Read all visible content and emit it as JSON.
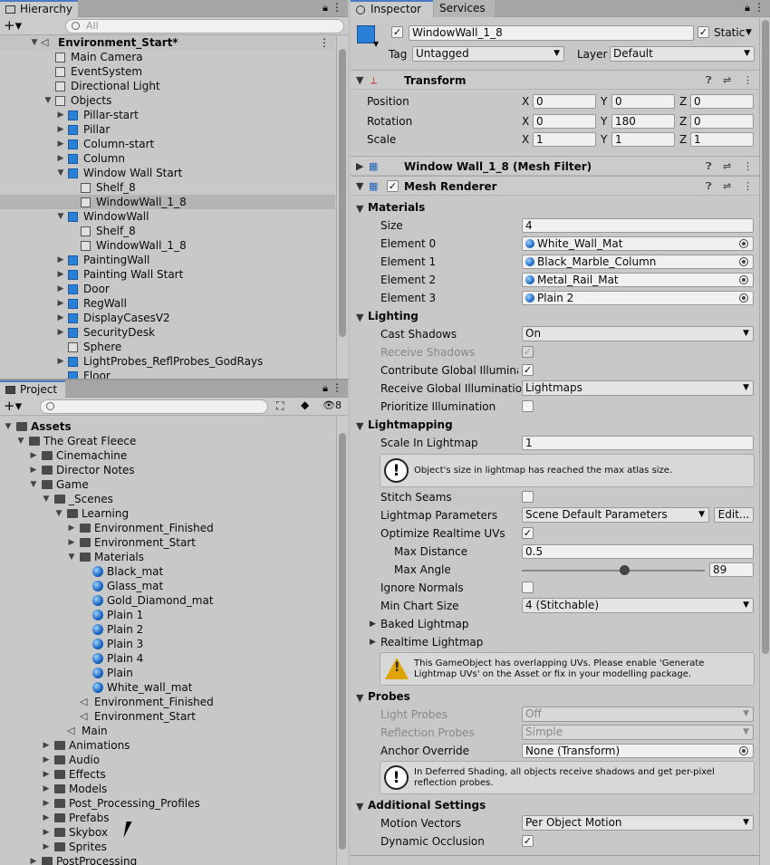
{
  "hierarchy": {
    "tab": "Hierarchy",
    "search_placeholder": "All",
    "scene": "Environment_Start*",
    "items": [
      {
        "label": "Main Camera"
      },
      {
        "label": "EventSystem"
      },
      {
        "label": "Directional Light"
      },
      {
        "label": "Objects"
      },
      {
        "label": "Pillar-start"
      },
      {
        "label": "Pillar"
      },
      {
        "label": "Column-start"
      },
      {
        "label": "Column"
      },
      {
        "label": "Window Wall Start"
      },
      {
        "label": "Shelf_8"
      },
      {
        "label": "WindowWall_1_8"
      },
      {
        "label": "WindowWall"
      },
      {
        "label": "Shelf_8"
      },
      {
        "label": "WindowWall_1_8"
      },
      {
        "label": "PaintingWall"
      },
      {
        "label": "Painting Wall Start"
      },
      {
        "label": "Door"
      },
      {
        "label": "RegWall"
      },
      {
        "label": "DisplayCasesV2"
      },
      {
        "label": "SecurityDesk"
      },
      {
        "label": "Sphere"
      },
      {
        "label": "LightProbes_ReflProbes_GodRays"
      },
      {
        "label": "Floor"
      }
    ]
  },
  "project": {
    "tab": "Project",
    "hidden_count": "8",
    "items": [
      {
        "label": "Assets"
      },
      {
        "label": "The Great Fleece"
      },
      {
        "label": "Cinemachine"
      },
      {
        "label": "Director Notes"
      },
      {
        "label": "Game"
      },
      {
        "label": "_Scenes"
      },
      {
        "label": "Learning"
      },
      {
        "label": "Environment_Finished"
      },
      {
        "label": "Environment_Start"
      },
      {
        "label": "Materials"
      },
      {
        "label": "Black_mat"
      },
      {
        "label": "Glass_mat"
      },
      {
        "label": "Gold_Diamond_mat"
      },
      {
        "label": "Plain 1"
      },
      {
        "label": "Plain 2"
      },
      {
        "label": "Plain 3"
      },
      {
        "label": "Plain 4"
      },
      {
        "label": "Plain"
      },
      {
        "label": "White_wall_mat"
      },
      {
        "label": "Environment_Finished"
      },
      {
        "label": "Environment_Start"
      },
      {
        "label": "Main"
      },
      {
        "label": "Animations"
      },
      {
        "label": "Audio"
      },
      {
        "label": "Effects"
      },
      {
        "label": "Models"
      },
      {
        "label": "Post_Processing_Profiles"
      },
      {
        "label": "Prefabs"
      },
      {
        "label": "Skybox"
      },
      {
        "label": "Sprites"
      },
      {
        "label": "PostProcessing"
      }
    ]
  },
  "inspector": {
    "tabs": [
      "Inspector",
      "Services"
    ],
    "object_name": "WindowWall_1_8",
    "static_label": "Static",
    "tag_label": "Tag",
    "tag_value": "Untagged",
    "layer_label": "Layer",
    "layer_value": "Default",
    "transform": {
      "title": "Transform",
      "position_label": "Position",
      "rotation_label": "Rotation",
      "scale_label": "Scale",
      "axes": [
        "X",
        "Y",
        "Z"
      ],
      "position": [
        "0",
        "0",
        "0"
      ],
      "rotation": [
        "0",
        "180",
        "0"
      ],
      "scale": [
        "1",
        "1",
        "1"
      ]
    },
    "mesh_filter_title": "Window Wall_1_8 (Mesh Filter)",
    "mesh_renderer_title": "Mesh Renderer",
    "materials": {
      "header": "Materials",
      "size_label": "Size",
      "size": "4",
      "elements": [
        {
          "label": "Element 0",
          "value": "White_Wall_Mat"
        },
        {
          "label": "Element 1",
          "value": "Black_Marble_Column"
        },
        {
          "label": "Element 2",
          "value": "Metal_Rail_Mat"
        },
        {
          "label": "Element 3",
          "value": "Plain 2"
        }
      ]
    },
    "lighting": {
      "header": "Lighting",
      "cast_shadows_label": "Cast Shadows",
      "cast_shadows": "On",
      "receive_shadows_label": "Receive Shadows",
      "contribute_gi_label": "Contribute Global Illuminati",
      "receive_gi_label": "Receive Global Illumination",
      "receive_gi": "Lightmaps",
      "prioritize_label": "Prioritize Illumination"
    },
    "lightmapping": {
      "header": "Lightmapping",
      "scale_label": "Scale In Lightmap",
      "scale": "1",
      "scale_note": "Object's size in lightmap has reached the max atlas size.",
      "stitch_label": "Stitch Seams",
      "params_label": "Lightmap Parameters",
      "params": "Scene Default Parameters",
      "edit_button": "Edit...",
      "optimize_label": "Optimize Realtime UVs",
      "max_distance_label": "Max Distance",
      "max_distance": "0.5",
      "max_angle_label": "Max Angle",
      "max_angle": "89",
      "max_angle_fraction": 0.56,
      "ignore_normals_label": "Ignore Normals",
      "min_chart_label": "Min Chart Size",
      "min_chart": "4 (Stitchable)",
      "baked_label": "Baked Lightmap",
      "realtime_label": "Realtime Lightmap",
      "warning": "This GameObject has overlapping UVs. Please enable 'Generate Lightmap UVs' on the Asset or fix in your modelling package."
    },
    "probes": {
      "header": "Probes",
      "light_probes_label": "Light Probes",
      "light_probes": "Off",
      "reflection_probes_label": "Reflection Probes",
      "reflection_probes": "Simple",
      "anchor_label": "Anchor Override",
      "anchor": "None (Transform)",
      "note": "In Deferred Shading, all objects receive shadows and get per-pixel reflection probes."
    },
    "additional": {
      "header": "Additional Settings",
      "motion_label": "Motion Vectors",
      "motion": "Per Object Motion",
      "occlusion_label": "Dynamic Occlusion"
    }
  }
}
